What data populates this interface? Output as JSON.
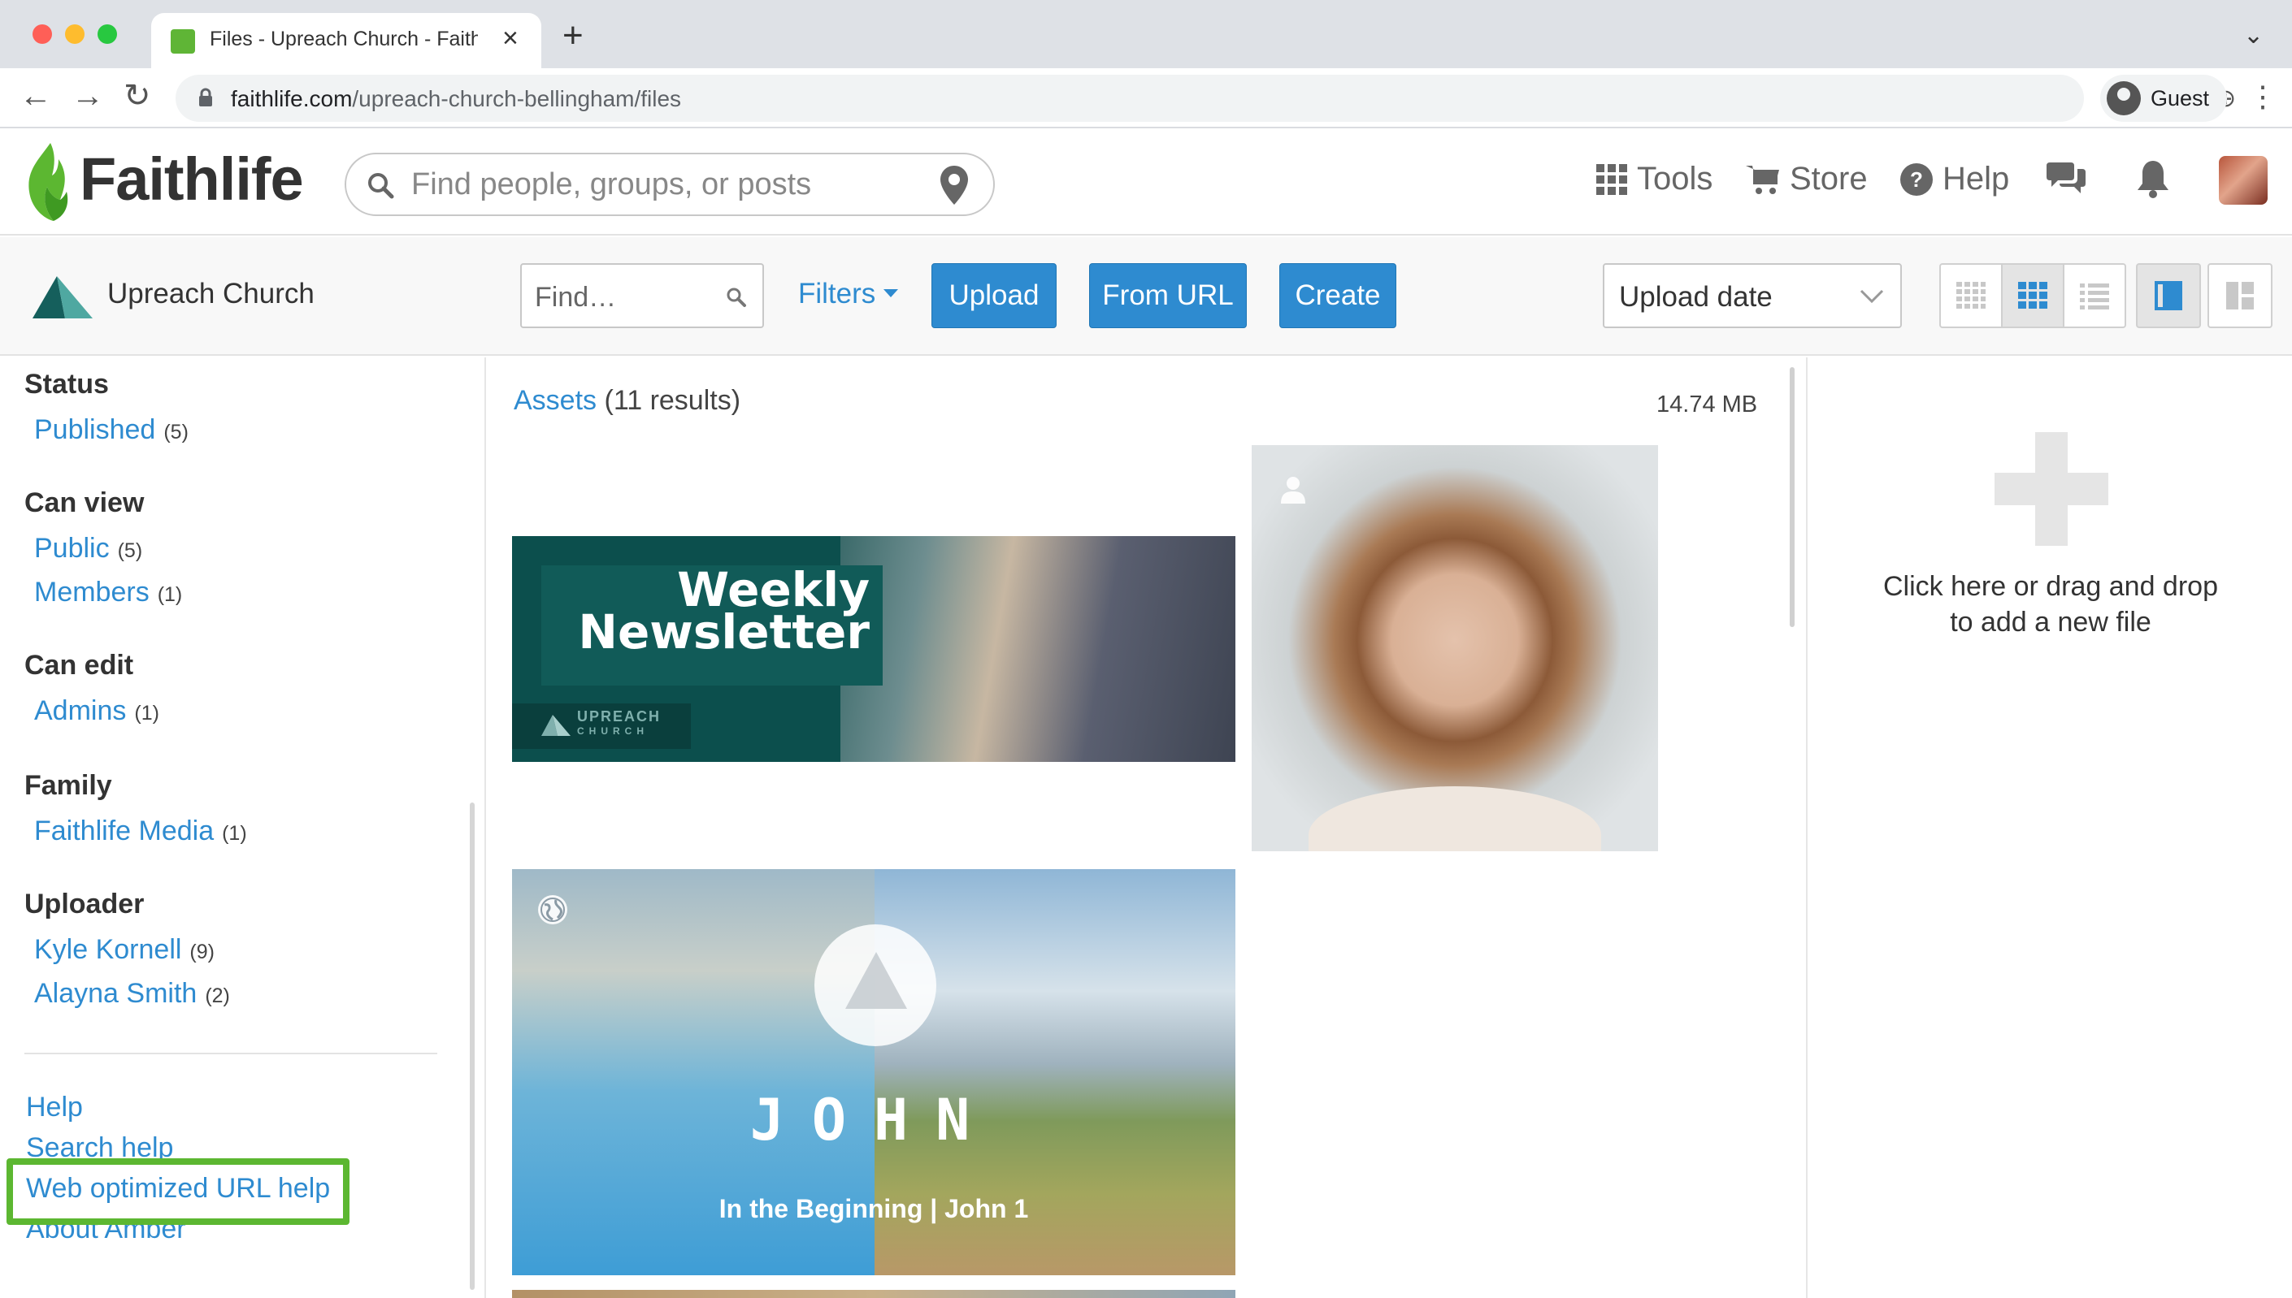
{
  "browser": {
    "tab_title": "Files - Upreach Church - Faithlife",
    "url_host": "faithlife.com",
    "url_path": "/upreach-church-bellingham/files",
    "profile_label": "Guest"
  },
  "site": {
    "logo_text": "Faithlife",
    "search_placeholder": "Find people, groups, or posts",
    "nav": {
      "tools": "Tools",
      "store": "Store",
      "help": "Help"
    }
  },
  "group": {
    "name": "Upreach Church",
    "find_placeholder": "Find…",
    "filters_label": "Filters",
    "upload_label": "Upload",
    "from_url_label": "From URL",
    "create_label": "Create",
    "sort_value": "Upload date"
  },
  "sidebar": {
    "facets": [
      {
        "heading": "Status",
        "items": [
          {
            "label": "Published",
            "count": "(5)"
          }
        ]
      },
      {
        "heading": "Can view",
        "items": [
          {
            "label": "Public",
            "count": "(5)"
          },
          {
            "label": "Members",
            "count": "(1)"
          }
        ]
      },
      {
        "heading": "Can edit",
        "items": [
          {
            "label": "Admins",
            "count": "(1)"
          }
        ]
      },
      {
        "heading": "Family",
        "items": [
          {
            "label": "Faithlife Media",
            "count": "(1)"
          }
        ]
      },
      {
        "heading": "Uploader",
        "items": [
          {
            "label": "Kyle Kornell",
            "count": "(9)"
          },
          {
            "label": "Alayna Smith",
            "count": "(2)"
          }
        ]
      }
    ],
    "links": {
      "help": "Help",
      "search_help": "Search help",
      "web_optimized": "Web optimized URL help",
      "about": "About Amber"
    }
  },
  "main": {
    "results_link": "Assets",
    "results_count": "(11 results)",
    "total_size": "14.74 MB",
    "newsletter": {
      "title": "Weekly Newsletter",
      "brand": "UPREACH",
      "brand_sub": "CHURCH"
    },
    "john": {
      "title": "JOHN",
      "subtitle": "In the Beginning | John 1"
    }
  },
  "right_panel": {
    "drop_line1": "Click here or drag and drop",
    "drop_line2": "to add a new file"
  },
  "colors": {
    "link_blue": "#2e8bd0",
    "faithlife_green": "#5cb731",
    "highlight_green": "#5cb731"
  }
}
